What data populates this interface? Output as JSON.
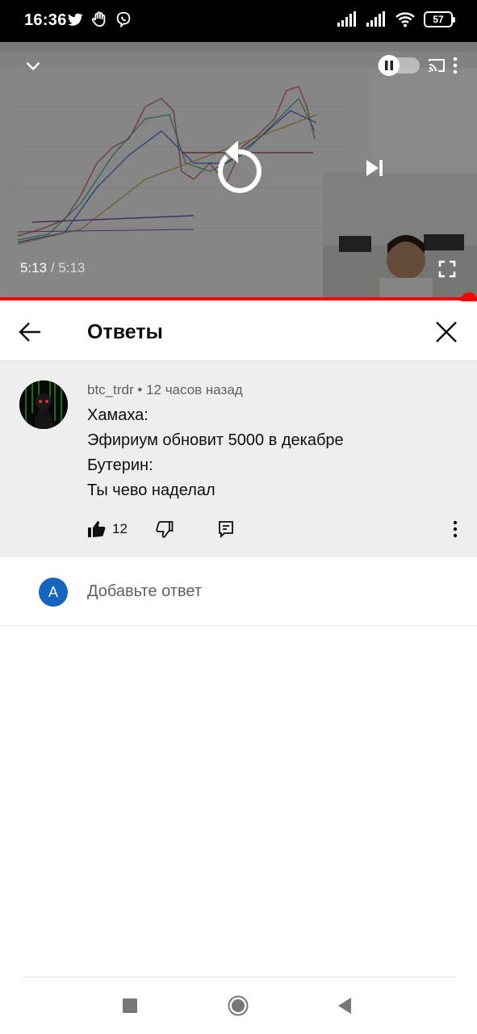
{
  "status_bar": {
    "time": "16:36",
    "battery": "57",
    "left_icons": [
      "twitter-icon",
      "hand-icon",
      "viber-icon"
    ],
    "right_icons": [
      "signal-icon",
      "signal-icon",
      "wifi-icon",
      "battery-icon"
    ]
  },
  "player": {
    "current_time": "5:13",
    "separator": "/",
    "duration": "5:13",
    "progress": 1.0,
    "accent_color": "#ff0000",
    "controls": [
      "collapse-icon",
      "pause-icon",
      "autoplay-toggle",
      "cast-icon",
      "more-icon",
      "replay-icon",
      "next-icon",
      "fullscreen-icon"
    ]
  },
  "replies_panel": {
    "title": "Ответы"
  },
  "comment": {
    "author": "btc_trdr",
    "dot": "•",
    "time_ago": "12 часов назад",
    "lines": [
      "Хамаха:",
      "Эфириум обновит 5000 в декабре",
      "Бутерин:",
      "Ты чево наделал"
    ],
    "like_count": "12"
  },
  "add_reply": {
    "avatar_letter": "A",
    "placeholder": "Добавьте ответ",
    "avatar_color": "#1565c0"
  },
  "nav_bar": {
    "buttons": [
      "recents-icon",
      "home-icon",
      "back-icon"
    ]
  }
}
